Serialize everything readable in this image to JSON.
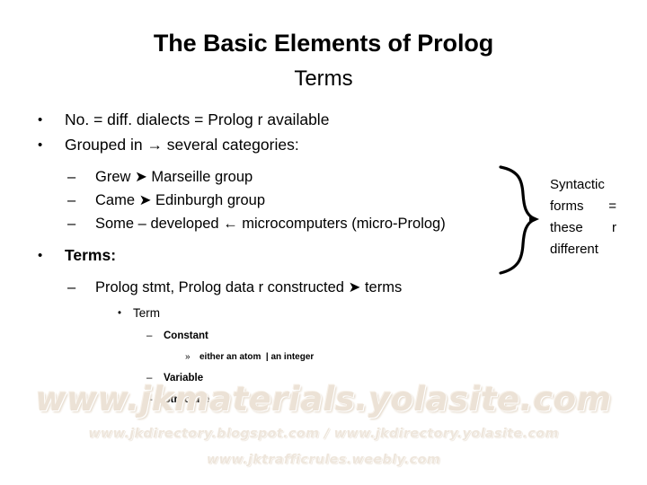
{
  "slide": {
    "title": "The Basic Elements of Prolog",
    "subtitle": "Terms",
    "bullets": [
      {
        "level": 1,
        "marker": "•",
        "text": "No. = diff. dialects = Prolog r available",
        "bold": false
      },
      {
        "level": 1,
        "marker": "•",
        "text": "Grouped in → several categories:",
        "bold": false
      },
      {
        "level": 2,
        "marker": "–",
        "text": "Grew ➤ Marseille group",
        "bold": false
      },
      {
        "level": 2,
        "marker": "–",
        "text": "Came ➤ Edinburgh group",
        "bold": false
      },
      {
        "level": 2,
        "marker": "–",
        "text": "Some – developed ← microcomputers (micro-Prolog)",
        "bold": false
      },
      {
        "level": 1,
        "marker": "•",
        "text": "Terms:",
        "bold": true
      },
      {
        "level": 2,
        "marker": "–",
        "text": "Prolog stmt, Prolog data r constructed ➤ terms",
        "bold": false
      },
      {
        "level": 3,
        "marker": "•",
        "text": "Term",
        "bold": false
      },
      {
        "level": 4,
        "marker": "–",
        "text": "Constant",
        "bold": true
      },
      {
        "level": 5,
        "marker": "»",
        "text": "either an atom  | an integer",
        "bold": true
      },
      {
        "level": 4,
        "marker": "–",
        "text": "Variable",
        "bold": true
      },
      {
        "level": 4,
        "marker": "–",
        "text": "Structure",
        "bold": true
      }
    ],
    "annotation": {
      "line1": "Syntactic",
      "line2_left": "forms",
      "line2_right": "=",
      "line3_left": "these",
      "line3_right": "r",
      "line4": "different",
      "brace_icon": "curly-brace-right"
    },
    "watermarks": {
      "main": "www.jkmaterials.yolasite.com",
      "sub1": "www.jkdirectory.blogspot.com / www.jkdirectory.yolasite.com",
      "sub2": "www.jktrafficrules.weebly.com"
    },
    "colors": {
      "text": "#000000",
      "background": "#ffffff",
      "watermark": "#ece2d6"
    }
  }
}
